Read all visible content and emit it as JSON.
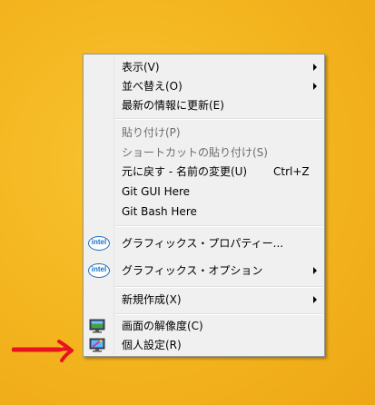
{
  "menu": {
    "items": [
      {
        "label": "表示(V)",
        "has_submenu": true
      },
      {
        "label": "並べ替え(O)",
        "has_submenu": true
      },
      {
        "label": "最新の情報に更新(E)"
      },
      {
        "label": "貼り付け(P)",
        "disabled": true
      },
      {
        "label": "ショートカットの貼り付け(S)",
        "disabled": true
      },
      {
        "label": "元に戻す - 名前の変更(U)",
        "shortcut": "Ctrl+Z"
      },
      {
        "label": "Git GUI Here"
      },
      {
        "label": "Git Bash Here"
      },
      {
        "label": "グラフィックス・プロパティー...",
        "icon": "intel-graphics-icon",
        "icon_text": "intel"
      },
      {
        "label": "グラフィックス・オプション",
        "icon": "intel-graphics-icon",
        "icon_text": "intel",
        "has_submenu": true
      },
      {
        "label": "新規作成(X)",
        "has_submenu": true
      },
      {
        "label": "画面の解像度(C)",
        "icon": "display-resolution-icon"
      },
      {
        "label": "個人設定(R)",
        "icon": "personalize-icon"
      }
    ]
  },
  "colors": {
    "desktop_background": "#f3b41e",
    "menu_background": "#f0f0f0",
    "menu_border": "#979797",
    "disabled_text": "#6d6d6d",
    "annotation_arrow": "#e8121e"
  }
}
